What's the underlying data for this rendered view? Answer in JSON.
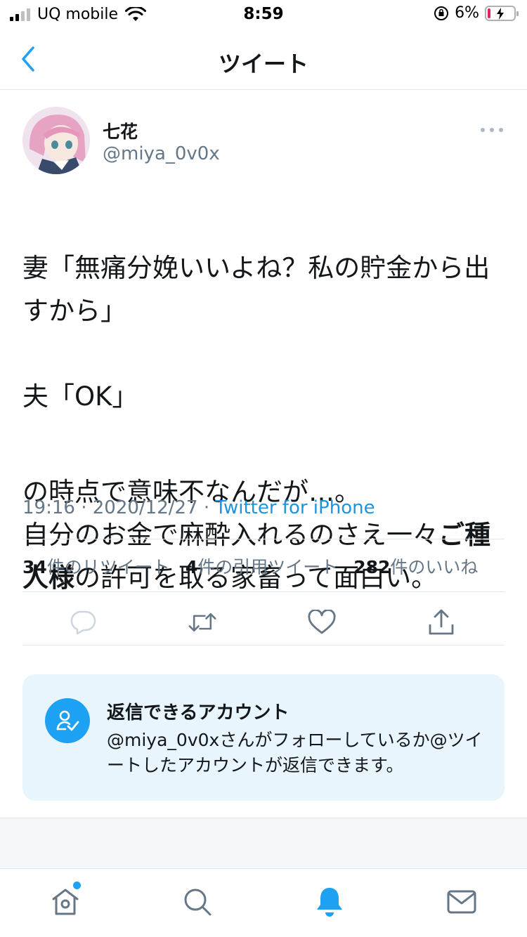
{
  "status_bar": {
    "carrier": "UQ mobile",
    "time": "8:59",
    "battery": "6%"
  },
  "header": {
    "title": "ツイート"
  },
  "tweet": {
    "author": {
      "name": "七花",
      "handle": "@miya_0v0x"
    },
    "text": {
      "l1": "妻「無痛分娩いいよね？私の貯金から出すから」",
      "l2": "夫「OK」",
      "l3": "の時点で意味不なんだが…。",
      "l4a": "自分のお金で麻酔入れるのさえ一々",
      "l4b": "ご種人様",
      "l4c": "の許可を取る家畜って面白い。"
    },
    "meta": {
      "time": "19:16",
      "date": "2020/12/27",
      "separator": "·",
      "source": "Twitter for iPhone"
    },
    "stats": {
      "retweets_count": "34",
      "retweets_label": "件のリツイート",
      "quotes_count": "4",
      "quotes_label": "件の引用ツイート",
      "likes_count": "282",
      "likes_label": "件のいいね"
    }
  },
  "reply_card": {
    "title": "返信できるアカウント",
    "body": "@miya_0v0xさんがフォローしているか@ツイートしたアカウントが返信できます。"
  },
  "tabbar": {
    "items": [
      "home-icon",
      "search-icon",
      "notifications-icon",
      "messages-icon"
    ],
    "active": "notifications"
  },
  "colors": {
    "accent": "#1da1f2",
    "link": "#1b95e0",
    "muted": "#657786",
    "card_bg": "#e8f5fd"
  }
}
